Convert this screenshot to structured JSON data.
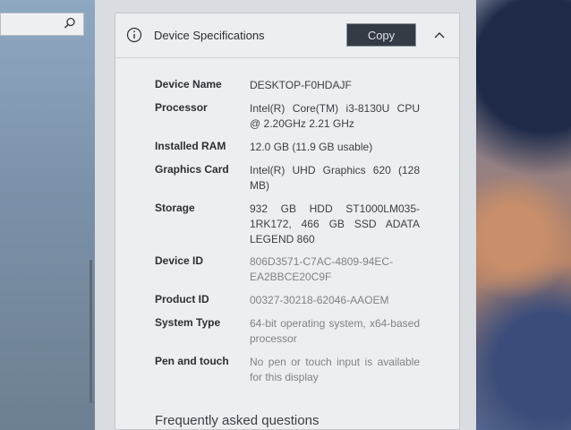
{
  "search": {
    "value": ""
  },
  "card": {
    "title": "Device Specifications",
    "copy_label": "Copy"
  },
  "specs": [
    {
      "label": "Device Name",
      "value": "DESKTOP-F0HDAJF"
    },
    {
      "label": "Processor",
      "value": "Intel(R) Core(TM) i3-8130U CPU @ 2.20GHz 2.21 GHz"
    },
    {
      "label": "Installed RAM",
      "value": "12.0 GB (11.9 GB usable)"
    },
    {
      "label": "Graphics Card",
      "value": "Intel(R) UHD Graphics 620 (128 MB)"
    },
    {
      "label": "Storage",
      "value": "932 GB HDD ST1000LM035-1RK172, 466 GB SSD ADATA LEGEND 860"
    },
    {
      "label": "Device ID",
      "value": "806D3571-C7AC-4809-94EC-EA2BBCE20C9F"
    },
    {
      "label": "Product ID",
      "value": "00327-30218-62046-AAOEM"
    },
    {
      "label": "System Type",
      "value": "64-bit operating system, x64-based processor"
    },
    {
      "label": "Pen and touch",
      "value": "No pen or touch input is available for this display"
    }
  ],
  "faq": {
    "heading": "Frequently asked questions"
  }
}
